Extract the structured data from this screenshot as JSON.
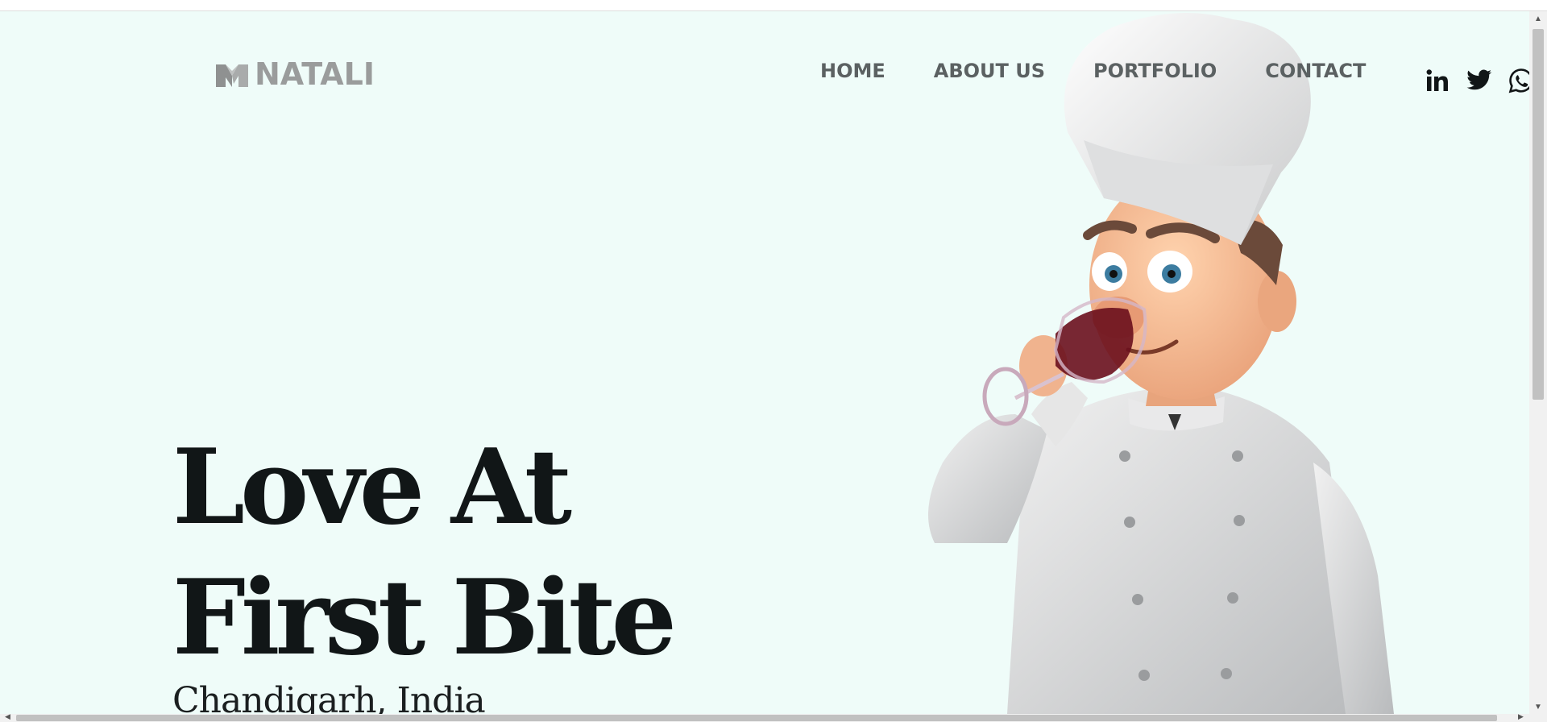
{
  "brand": {
    "name": "NATALI",
    "logo_icon": "natali-logo-icon",
    "color": "#9a9c9c"
  },
  "nav": {
    "items": [
      {
        "label": "HOME"
      },
      {
        "label": "ABOUT US"
      },
      {
        "label": "PORTFOLIO"
      },
      {
        "label": "CONTACT"
      }
    ]
  },
  "social": {
    "icons": [
      "linkedin-icon",
      "twitter-icon",
      "whatsapp-icon"
    ]
  },
  "hero": {
    "title_line1": "Love At",
    "title_line2": "First Bite",
    "subtitle": "Chandigarh, India",
    "background": "#effcf9",
    "image": "chef-drinking-wine-illustration"
  }
}
